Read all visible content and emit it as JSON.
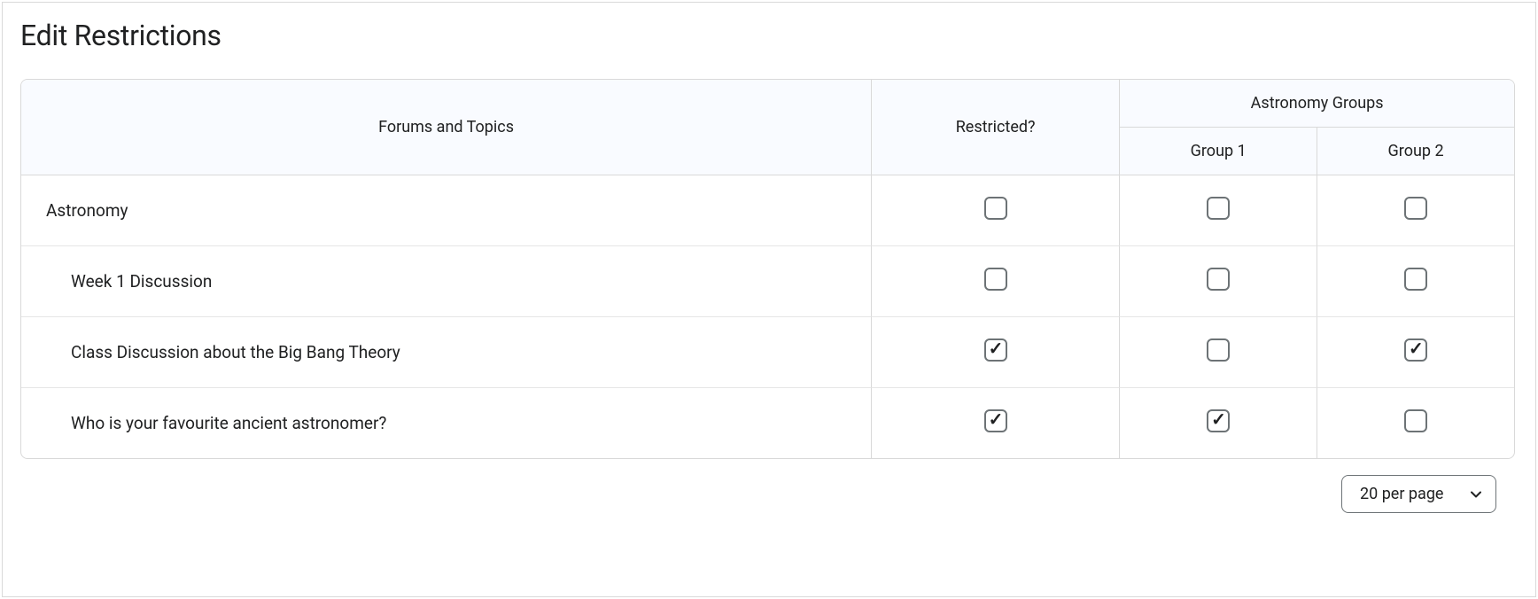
{
  "title": "Edit Restrictions",
  "headers": {
    "forums_topics": "Forums and Topics",
    "restricted": "Restricted?",
    "group_category": "Astronomy Groups",
    "groups": [
      "Group 1",
      "Group 2"
    ]
  },
  "rows": [
    {
      "name": "Astronomy",
      "indent": false,
      "restricted": false,
      "groups": [
        false,
        false
      ]
    },
    {
      "name": "Week 1 Discussion",
      "indent": true,
      "restricted": false,
      "groups": [
        false,
        false
      ]
    },
    {
      "name": "Class Discussion about the Big Bang Theory",
      "indent": true,
      "restricted": true,
      "groups": [
        false,
        true
      ]
    },
    {
      "name": "Who is your favourite ancient astronomer?",
      "indent": true,
      "restricted": true,
      "groups": [
        true,
        false
      ]
    }
  ],
  "pager": {
    "selected": "20 per page"
  }
}
